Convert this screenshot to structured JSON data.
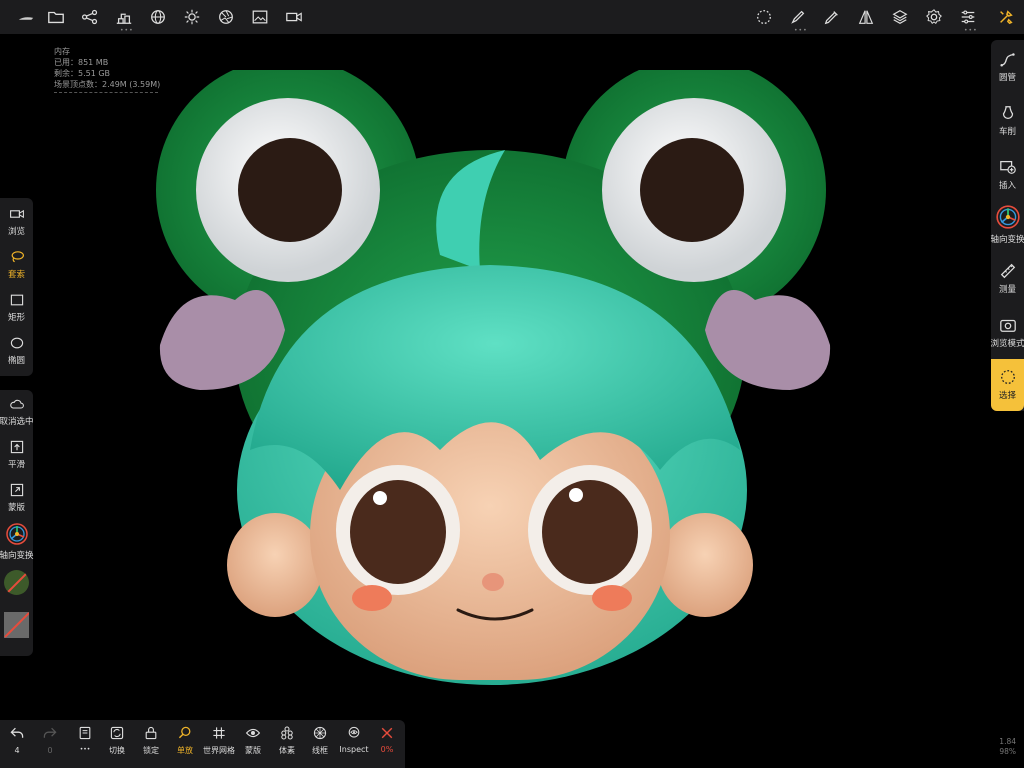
{
  "memory": {
    "title": "内存",
    "used": "已用：851 MB",
    "free": "剩余：5.51 GB",
    "vertices": "场景顶点数：2.49M (3.59M)"
  },
  "left_panel_top": [
    {
      "label": "浏览",
      "icon": "camera-icon"
    },
    {
      "label": "套索",
      "icon": "lasso-icon",
      "active": true
    },
    {
      "label": "矩形",
      "icon": "rectangle-icon"
    },
    {
      "label": "椭圆",
      "icon": "ellipse-icon"
    }
  ],
  "left_panel_bottom": [
    {
      "label": "取消选中",
      "icon": "cloud-icon"
    },
    {
      "label": "平滑",
      "icon": "smooth-icon"
    },
    {
      "label": "蒙版",
      "icon": "mask-icon"
    },
    {
      "label": "轴向变换",
      "icon": "gizmo-icon"
    }
  ],
  "right_panel": [
    {
      "label": "圆管",
      "icon": "tube-icon"
    },
    {
      "label": "车削",
      "icon": "lathe-icon"
    },
    {
      "label": "插入",
      "icon": "insert-icon"
    },
    {
      "label": "轴向变换",
      "icon": "gizmo-icon"
    },
    {
      "label": "测量",
      "icon": "ruler-icon"
    },
    {
      "label": "浏览模式",
      "icon": "camera-icon"
    },
    {
      "label": "选择",
      "icon": "select-icon",
      "active": true
    }
  ],
  "bottom_bar": {
    "undo_count": "4",
    "redo_count": "0",
    "items": [
      {
        "label": "切换",
        "icon": "swap-icon"
      },
      {
        "label": "锁定",
        "icon": "lock-icon"
      },
      {
        "label": "单放",
        "icon": "search-icon",
        "active": true
      },
      {
        "label": "世界网格",
        "icon": "grid-icon"
      },
      {
        "label": "蒙版",
        "icon": "eye-icon"
      },
      {
        "label": "体素",
        "icon": "voxel-icon"
      },
      {
        "label": "线框",
        "icon": "wireframe-icon"
      },
      {
        "label": "Inspect",
        "icon": "inspect-icon"
      },
      {
        "label": "0%",
        "icon": "close-icon"
      }
    ]
  },
  "corner": {
    "line1": "1.84",
    "line2": "98%"
  },
  "colors": {
    "accent": "#f0b429",
    "panel": "#1c1c1e",
    "danger": "#e74c3c",
    "select_bg": "#f5c13a"
  }
}
